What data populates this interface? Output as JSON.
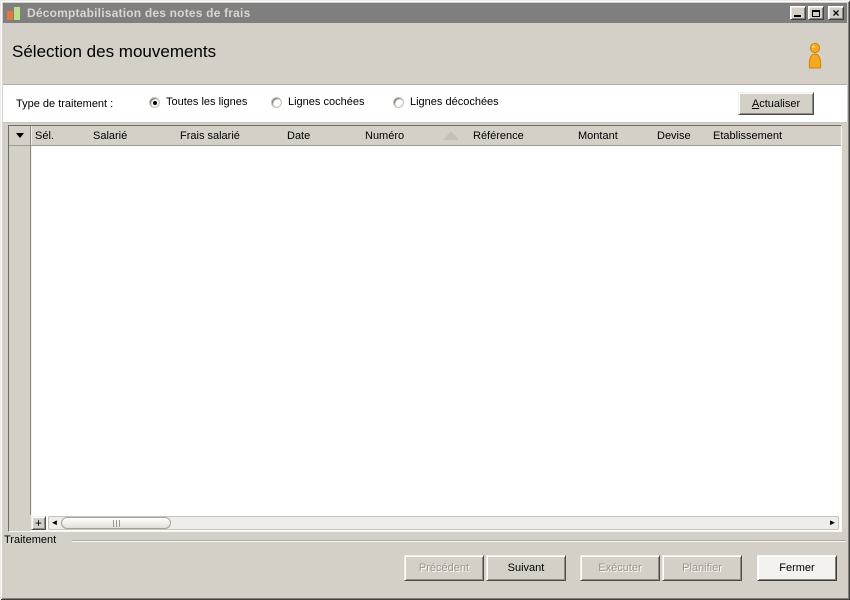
{
  "window": {
    "title": "Décomptabilisation des notes de frais"
  },
  "page": {
    "heading": "Sélection des mouvements"
  },
  "filter": {
    "label": "Type de traitement :",
    "options": [
      {
        "label": "Toutes les lignes",
        "selected": true
      },
      {
        "label": "Lignes cochées",
        "selected": false
      },
      {
        "label": "Lignes décochées",
        "selected": false
      }
    ],
    "refresh_button": {
      "mnemonic": "A",
      "rest": "ctualiser"
    }
  },
  "grid": {
    "columns": [
      "Sél.",
      "Salarié",
      "Frais salarié",
      "Date",
      "Numéro",
      "Référence",
      "Montant",
      "Devise",
      "Etablissement"
    ],
    "sorted_column": "Numéro",
    "sort_direction": "asc",
    "rows": [],
    "add_row_button": "+",
    "scroll_left_arrow": "◄",
    "scroll_right_arrow": "►"
  },
  "status": {
    "group_label": "Traitement"
  },
  "footer": {
    "buttons": [
      {
        "label": "Précédent",
        "enabled": false
      },
      {
        "label": "Suivant",
        "enabled": true
      },
      {
        "label": "Exécuter",
        "enabled": false
      },
      {
        "label": "Planifier",
        "enabled": false
      },
      {
        "label": "Fermer",
        "enabled": true
      }
    ]
  },
  "colors": {
    "titlebar_bg": "#7f7f7f",
    "window_bg": "#d4d0c8",
    "person_icon_orange": "#f5a91f",
    "title_icon_orange": "#e8763a",
    "title_icon_green": "#b9e08c"
  }
}
